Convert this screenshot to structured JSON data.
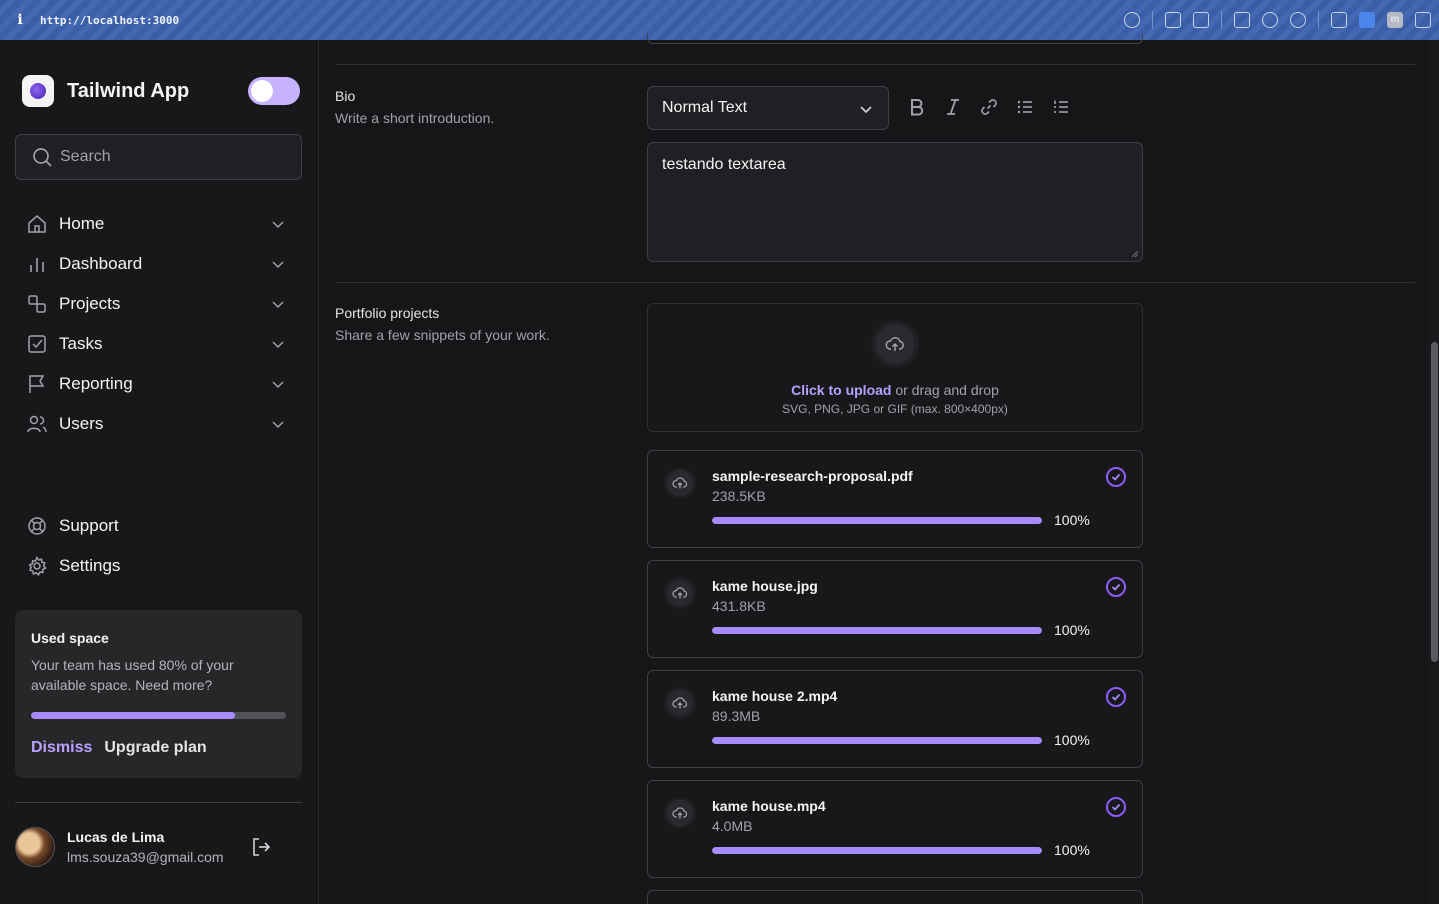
{
  "browser": {
    "url": "http://localhost:3000",
    "info_icon": "i"
  },
  "sidebar": {
    "app_name": "Tailwind App",
    "search_placeholder": "Search",
    "nav": [
      {
        "label": "Home",
        "icon": "home-icon"
      },
      {
        "label": "Dashboard",
        "icon": "bar-chart-icon"
      },
      {
        "label": "Projects",
        "icon": "squares-icon"
      },
      {
        "label": "Tasks",
        "icon": "check-square-icon"
      },
      {
        "label": "Reporting",
        "icon": "flag-icon"
      },
      {
        "label": "Users",
        "icon": "users-icon"
      }
    ],
    "secondary_nav": [
      {
        "label": "Support",
        "icon": "lifebuoy-icon"
      },
      {
        "label": "Settings",
        "icon": "gear-icon"
      }
    ],
    "usage": {
      "title": "Used space",
      "description": "Your team has used 80% of your available space. Need more?",
      "percent": 80,
      "dismiss": "Dismiss",
      "upgrade": "Upgrade plan"
    },
    "user": {
      "name": "Lucas de Lima",
      "email": "lms.souza39@gmail.com"
    }
  },
  "form": {
    "bio": {
      "title": "Bio",
      "subtitle": "Write a short introduction.",
      "text_style": "Normal Text",
      "value": "testando textarea"
    },
    "portfolio": {
      "title": "Portfolio projects",
      "subtitle": "Share a few snippets of your work.",
      "upload_cta": "Click to upload",
      "upload_rest": " or drag and drop",
      "upload_hint": "SVG, PNG, JPG or GIF (max. 800×400px)",
      "files": [
        {
          "name": "sample-research-proposal.pdf",
          "size": "238.5KB",
          "progress": 100,
          "progress_label": "100%"
        },
        {
          "name": "kame house.jpg",
          "size": "431.8KB",
          "progress": 100,
          "progress_label": "100%"
        },
        {
          "name": "kame house 2.mp4",
          "size": "89.3MB",
          "progress": 100,
          "progress_label": "100%"
        },
        {
          "name": "kame house.mp4",
          "size": "4.0MB",
          "progress": 100,
          "progress_label": "100%"
        }
      ]
    }
  },
  "colors": {
    "accent": "#a78bfa",
    "accent_strong": "#8b5cf6",
    "background": "#161618"
  }
}
